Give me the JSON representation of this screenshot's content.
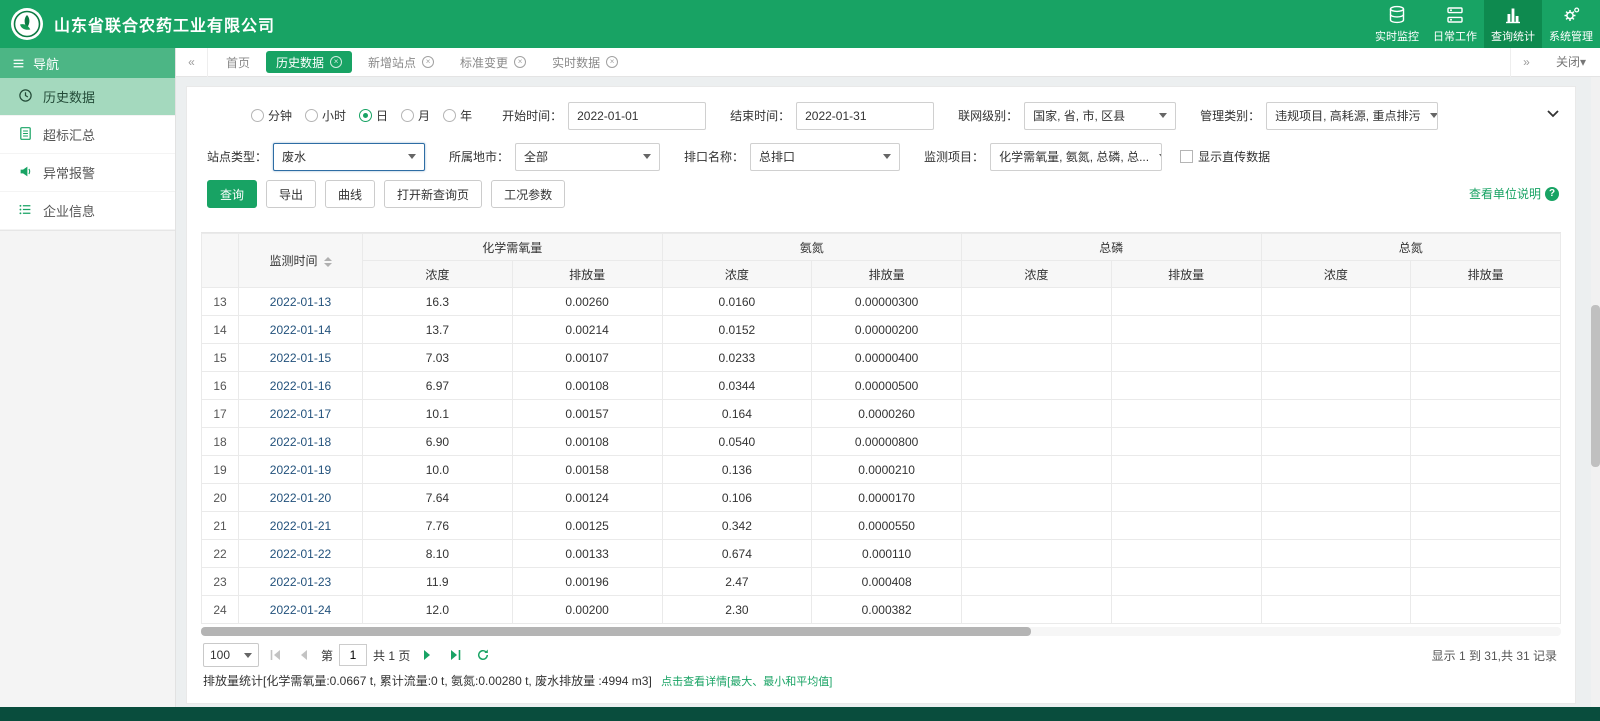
{
  "header": {
    "company": "山东省联合农药工业有限公司",
    "nav": [
      {
        "key": "realtime-monitor",
        "label": "实时监控",
        "icon": "database-icon",
        "active": false
      },
      {
        "key": "daily-work",
        "label": "日常工作",
        "icon": "server-icon",
        "active": false
      },
      {
        "key": "query-stats",
        "label": "查询统计",
        "icon": "bar-chart-icon",
        "active": true
      },
      {
        "key": "system-manage",
        "label": "系统管理",
        "icon": "gear-icon",
        "active": false
      }
    ]
  },
  "tabbar": {
    "left_arrow": "«",
    "right_arrow": "»",
    "close_menu": "关闭▾",
    "tabs": [
      {
        "key": "home",
        "label": "首页",
        "closable": false,
        "active": false
      },
      {
        "key": "history",
        "label": "历史数据",
        "closable": true,
        "active": true
      },
      {
        "key": "new-site",
        "label": "新增站点",
        "closable": true,
        "active": false
      },
      {
        "key": "standard-change",
        "label": "标准变更",
        "closable": true,
        "active": false
      },
      {
        "key": "realtime-data",
        "label": "实时数据",
        "closable": true,
        "active": false
      }
    ]
  },
  "sidebar": {
    "title": "导航",
    "items": [
      {
        "key": "history-data",
        "label": "历史数据",
        "icon": "clock-icon",
        "active": true
      },
      {
        "key": "over-limit",
        "label": "超标汇总",
        "icon": "document-icon",
        "active": false
      },
      {
        "key": "abnormal-alarm",
        "label": "异常报警",
        "icon": "speaker-icon",
        "active": false
      },
      {
        "key": "company-info",
        "label": "企业信息",
        "icon": "list-icon",
        "active": false
      }
    ]
  },
  "filters": {
    "period_options": [
      "分钟",
      "小时",
      "日",
      "月",
      "年"
    ],
    "period_selected": "日",
    "start_label": "开始时间：",
    "start_value": "2022-01-01",
    "end_label": "结束时间：",
    "end_value": "2022-01-31",
    "network_label": "联网级别：",
    "network_value": "国家, 省, 市, 区县",
    "manage_label": "管理类别：",
    "manage_value": "违规项目, 高耗源, 重点排污",
    "site_type_label": "站点类型：",
    "site_type_value": "废水",
    "city_label": "所属地市：",
    "city_value": "全部",
    "outlet_label": "排口名称：",
    "outlet_value": "总排口",
    "monitor_label": "监测项目：",
    "monitor_value": "化学需氧量, 氨氮, 总磷, 总...",
    "direct_checkbox_label": "显示直传数据"
  },
  "actions": {
    "query": "查询",
    "export": "导出",
    "curve": "曲线",
    "new_query_page": "打开新查询页",
    "work_params": "工况参数",
    "unit_help": "查看单位说明",
    "help_mark": "?"
  },
  "table": {
    "time_header": "监测时间",
    "groups": [
      "化学需氧量",
      "氨氮",
      "总磷",
      "总氮"
    ],
    "sub_headers": [
      "浓度",
      "排放量"
    ],
    "rows": [
      {
        "no": "13",
        "date": "2022-01-13",
        "values": [
          "16.3",
          "0.00260",
          "0.0160",
          "0.00000300",
          "",
          "",
          "",
          ""
        ]
      },
      {
        "no": "14",
        "date": "2022-01-14",
        "values": [
          "13.7",
          "0.00214",
          "0.0152",
          "0.00000200",
          "",
          "",
          "",
          ""
        ]
      },
      {
        "no": "15",
        "date": "2022-01-15",
        "values": [
          "7.03",
          "0.00107",
          "0.0233",
          "0.00000400",
          "",
          "",
          "",
          ""
        ]
      },
      {
        "no": "16",
        "date": "2022-01-16",
        "values": [
          "6.97",
          "0.00108",
          "0.0344",
          "0.00000500",
          "",
          "",
          "",
          ""
        ]
      },
      {
        "no": "17",
        "date": "2022-01-17",
        "values": [
          "10.1",
          "0.00157",
          "0.164",
          "0.0000260",
          "",
          "",
          "",
          ""
        ]
      },
      {
        "no": "18",
        "date": "2022-01-18",
        "values": [
          "6.90",
          "0.00108",
          "0.0540",
          "0.00000800",
          "",
          "",
          "",
          ""
        ]
      },
      {
        "no": "19",
        "date": "2022-01-19",
        "values": [
          "10.0",
          "0.00158",
          "0.136",
          "0.0000210",
          "",
          "",
          "",
          ""
        ]
      },
      {
        "no": "20",
        "date": "2022-01-20",
        "values": [
          "7.64",
          "0.00124",
          "0.106",
          "0.0000170",
          "",
          "",
          "",
          ""
        ]
      },
      {
        "no": "21",
        "date": "2022-01-21",
        "values": [
          "7.76",
          "0.00125",
          "0.342",
          "0.0000550",
          "",
          "",
          "",
          ""
        ]
      },
      {
        "no": "22",
        "date": "2022-01-22",
        "values": [
          "8.10",
          "0.00133",
          "0.674",
          "0.000110",
          "",
          "",
          "",
          ""
        ]
      },
      {
        "no": "23",
        "date": "2022-01-23",
        "values": [
          "11.9",
          "0.00196",
          "2.47",
          "0.000408",
          "",
          "",
          "",
          ""
        ]
      },
      {
        "no": "24",
        "date": "2022-01-24",
        "values": [
          "12.0",
          "0.00200",
          "2.30",
          "0.000382",
          "",
          "",
          "",
          ""
        ]
      }
    ]
  },
  "pagination": {
    "page_size": "100",
    "page_prefix": "第",
    "page_value": "1",
    "page_total": "共 1 页",
    "summary": "显示 1 到 31,共 31 记录"
  },
  "footer": {
    "stats": "排放量统计[化学需氧量:0.0667 t, 累计流量:0 t, 氨氮:0.00280 t, 废水排放量 :4994 m3]",
    "detail_link": "点击查看详情[最大、最小和平均值]"
  },
  "colors": {
    "primary_green": "#18a364",
    "dark_green_bar": "#094d3d",
    "active_nav": "#0e8a4f",
    "sidebar_selected": "#a4d9be"
  }
}
